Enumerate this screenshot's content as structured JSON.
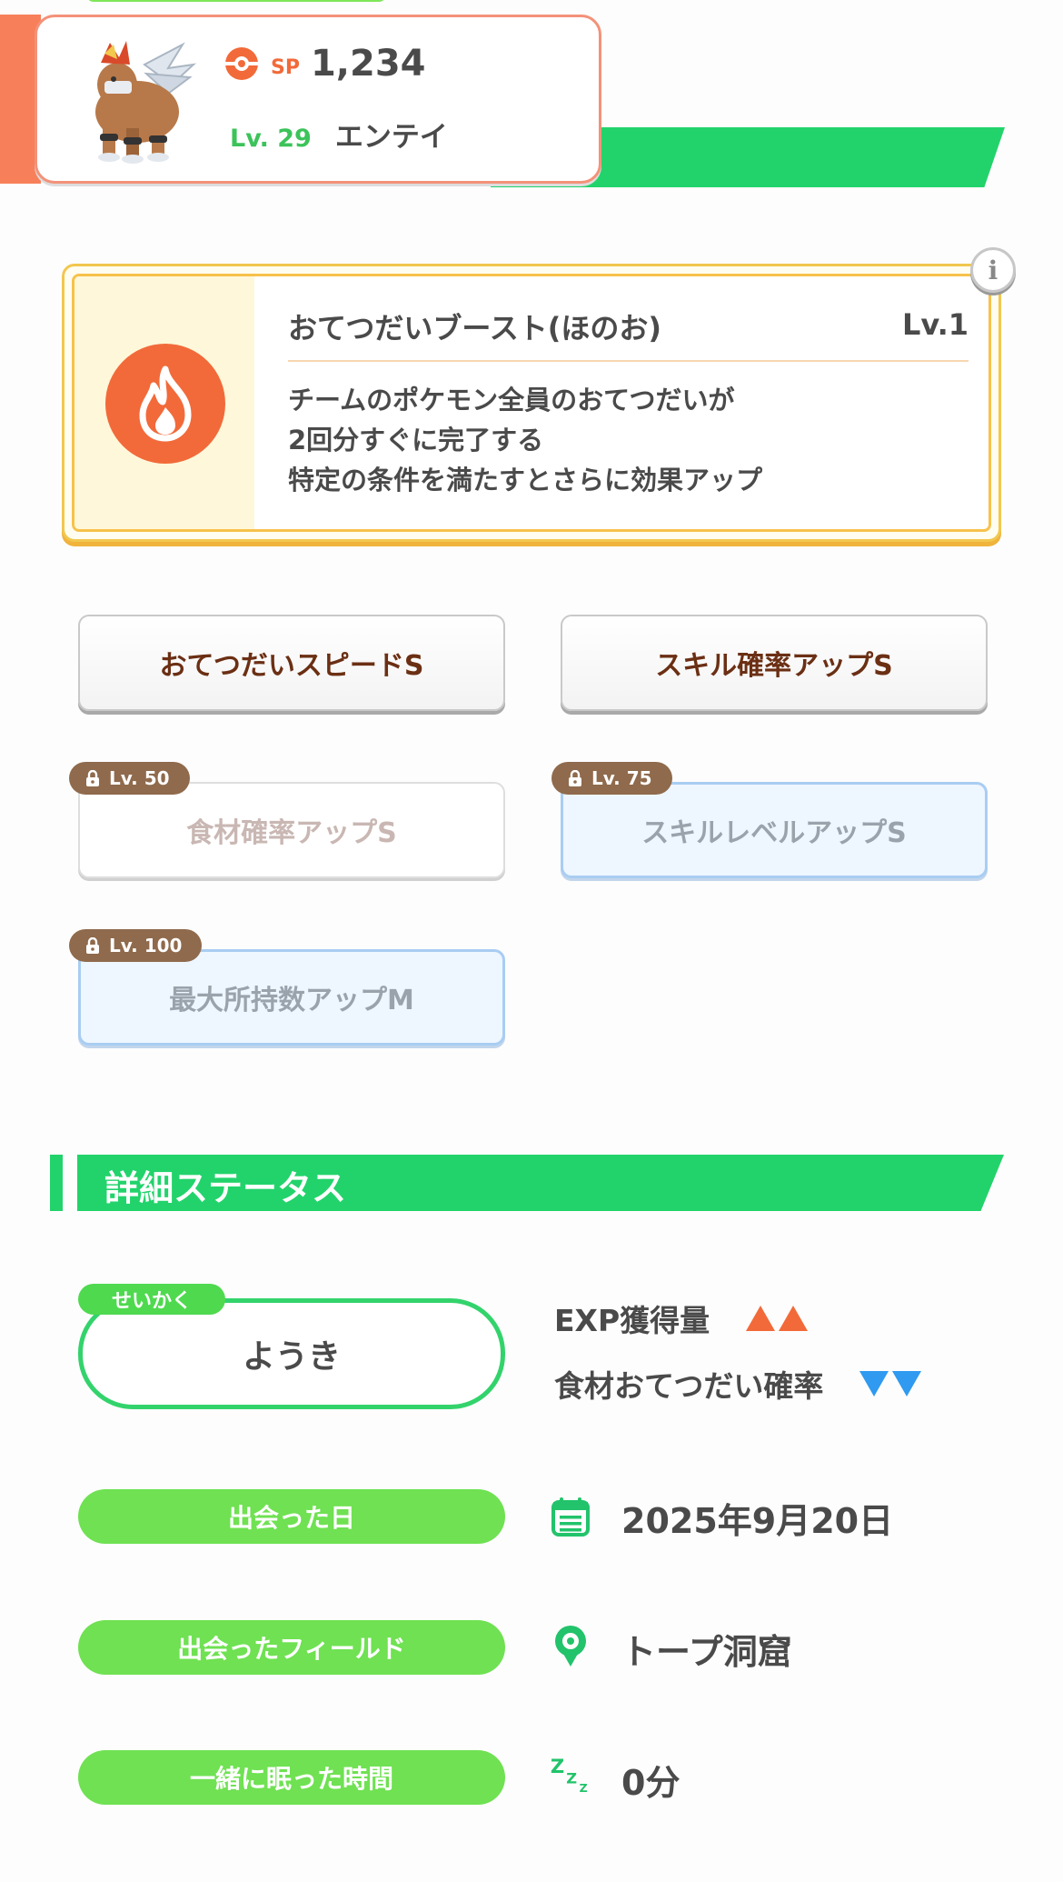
{
  "header": {
    "sp_label": "SP",
    "sp_value": "1,234",
    "level_label": "Lv. 29",
    "name": "エンテイ"
  },
  "main_skill": {
    "title": "おてつだいブースト(ほのお)",
    "level": "Lv.1",
    "description_lines": [
      "チームのポケモン全員のおてつだいが",
      "2回分すぐに完了する",
      "特定の条件を満たすとさらに効果アップ"
    ],
    "icon": "fire-icon",
    "info_label": "i"
  },
  "sub_skills": [
    {
      "label": "おてつだいスピードS",
      "unlocked": true
    },
    {
      "label": "スキル確率アップS",
      "unlocked": true
    },
    {
      "label": "食材確率アップS",
      "unlocked": false,
      "unlock_level": "Lv. 50"
    },
    {
      "label": "スキルレベルアップS",
      "unlocked": false,
      "unlock_level": "Lv. 75"
    },
    {
      "label": "最大所持数アップM",
      "unlocked": false,
      "unlock_level": "Lv. 100"
    }
  ],
  "details": {
    "section_title": "詳細ステータス",
    "nature_tag": "せいかく",
    "nature": "ようき",
    "nature_up": "EXP獲得量",
    "nature_down": "食材おてつだい確率",
    "met_date_label": "出会った日",
    "met_date": "2025年9月20日",
    "met_field_label": "出会ったフィールド",
    "met_field": "トープ洞窟",
    "sleep_label": "一緒に眠った時間",
    "sleep_value": "0分"
  },
  "colors": {
    "accent_green": "#22d36b",
    "pill_green": "#6fe152",
    "fire_orange": "#f26a3a",
    "down_blue": "#2f9af0",
    "lock_brown": "#8f6a4c"
  }
}
